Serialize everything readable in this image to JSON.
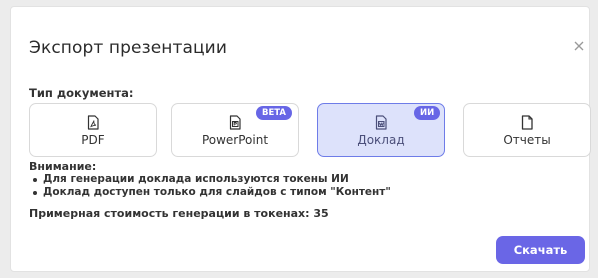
{
  "dialog": {
    "title": "Экспорт презентации",
    "doc_type_label": "Тип документа:",
    "options": [
      {
        "label": "PDF",
        "icon": "pdf-file-icon",
        "selected": false
      },
      {
        "label": "PowerPoint",
        "icon": "powerpoint-file-icon",
        "badge": "BETA",
        "selected": false
      },
      {
        "label": "Доклад",
        "icon": "word-file-icon",
        "badge": "ИИ",
        "selected": true
      },
      {
        "label": "Отчеты",
        "icon": "document-icon",
        "selected": false
      }
    ],
    "attention_label": "Внимание:",
    "notes": [
      "Для генерации доклада используются токены ИИ",
      "Доклад доступен только для слайдов с типом \"Контент\""
    ],
    "cost_text": "Примерная стоимость генерации в токенах: 35",
    "download_label": "Скачать"
  },
  "colors": {
    "accent": "#6a66e6",
    "selected_bg": "#dde2fb",
    "text": "#333333"
  }
}
